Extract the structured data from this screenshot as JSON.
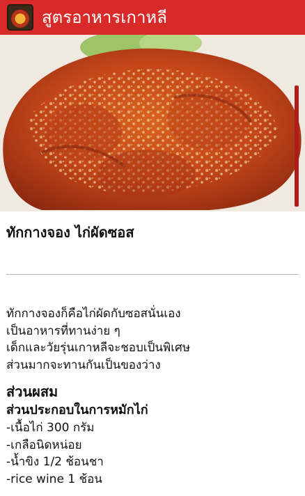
{
  "app": {
    "title": "สูตรอาหารเกาหลี",
    "icon": "app-food-icon",
    "accent_color": "#d92a2a"
  },
  "hero": {
    "image": "korean-fried-chicken-photo"
  },
  "recipe": {
    "title": "ทักกางจอง ไก่ผัดซอส",
    "intro_lines": [
      "ทักกางจองก็คือไก่ผัดกับซอสนั่นเอง",
      "เป็นอาหารที่ทานง่าย ๆ",
      "เด็กและวัยรุ่นเกาหลีจะชอบเป็นพิเศษ",
      "ส่วนมากจะทานกันเป็นของว่าง"
    ],
    "ingredients_heading": "ส่วนผสม",
    "marinade_heading": "ส่วนประกอบในการหมักไก่",
    "marinade_items": [
      "-เนื้อไก่ 300 กรัม",
      "-เกลือนิดหน่อย",
      "-น้ำขิง 1/2 ช้อนชา",
      "-rice wine 1 ช้อน"
    ]
  }
}
